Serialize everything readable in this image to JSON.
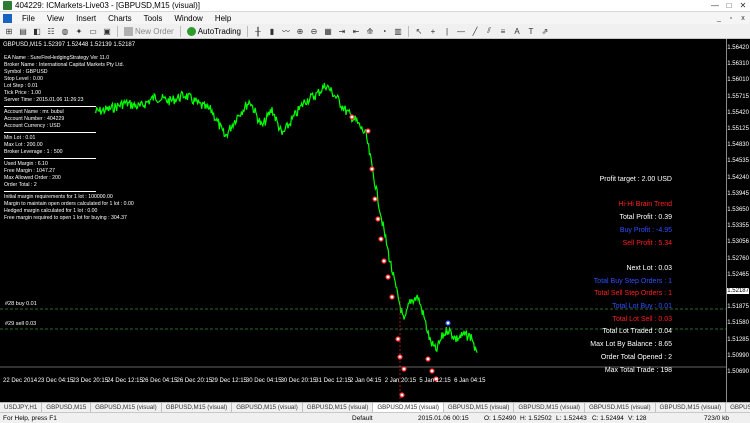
{
  "window": {
    "title": "404229: ICMarkets-Live03 - [GBPUSD,M15 (visual)]",
    "controls": [
      "—",
      "□",
      "✕"
    ]
  },
  "menu": {
    "items": [
      "File",
      "View",
      "Insert",
      "Charts",
      "Tools",
      "Window",
      "Help"
    ],
    "mdi_controls": [
      "_",
      "▫",
      "x"
    ]
  },
  "toolbar": {
    "new_order": "New Order",
    "autotrading": "AutoTrading",
    "icons": [
      "new-chart-icon",
      "open-icon",
      "profiles-icon",
      "market-watch-icon",
      "data-window-icon",
      "navigator-icon",
      "terminal-icon",
      "tester-icon",
      "new-order-icon",
      "autotrading-icon",
      "bar-chart-icon",
      "candlestick-icon",
      "line-chart-icon",
      "zoom-in-icon",
      "zoom-out-icon",
      "tile-icon",
      "autoscroll-icon",
      "chart-shift-icon",
      "indicators-icon",
      "periods-icon",
      "templates-icon",
      "cursor-icon",
      "crosshair-icon",
      "vertical-line-icon",
      "horizontal-line-icon",
      "trendline-icon",
      "channel-icon",
      "fibonacci-icon",
      "text-icon",
      "label-icon",
      "arrows-icon"
    ]
  },
  "chart": {
    "symbol_line": "GBPUSD,M15  1.52397 1.52448 1.52139 1.52187",
    "colors": {
      "background": "#000000",
      "price_line": "#00ff00",
      "sell_marker": "#ff3030",
      "buy_marker": "#3050ff",
      "trade_line": "#3a8a3a"
    },
    "info_panel": {
      "lines_1": [
        "EA Name : SureFireHedgingStrategy Ver 11.0",
        "Broker Name : International Capital Markets Pty Ltd.",
        "Symbol : GBPUSD",
        "Stop Level : 0.00",
        "Lot Step : 0.01",
        "Tick Price : 1.00",
        "Server Time : 2015.01.06 11:26:23"
      ],
      "lines_2": [
        "Account Name : mr. bubul",
        "Account Number : 404229",
        "Account Currency : USD"
      ],
      "lines_3": [
        "Min Lot : 0.01",
        "Max Lot : 200.00",
        "Broker Leverage : 1 : 500"
      ],
      "lines_4": [
        "Used Margin : 6.10",
        "Free Margin : 1047.27",
        "Max Allowed Order : 200",
        "Order Total : 2"
      ],
      "lines_5": [
        "Initial margin requirements for 1 lot : 100000.00",
        "Margin to maintain open orders calculated for 1 lot : 0.00",
        "Hedged margin calculated for 1 lot : 0.00",
        "Free margin required to open 1 lot for buying : 304.37"
      ]
    },
    "stats": [
      {
        "text": "Profit target : 2.00 USD",
        "color": "#ffffff"
      },
      {
        "text": "",
        "color": "#ffffff"
      },
      {
        "text": "Hi-Hi Brain Trend",
        "color": "#ff2020"
      },
      {
        "text": "Total Profit : 0.39",
        "color": "#ffffff"
      },
      {
        "text": "Buy Profit : -4.95",
        "color": "#3050ff"
      },
      {
        "text": "Sell Profit : 5.34",
        "color": "#ff2020"
      },
      {
        "text": "",
        "color": "#ffffff"
      },
      {
        "text": "Next Lot : 0.03",
        "color": "#ffffff"
      },
      {
        "text": "Total Buy Step Orders : 1",
        "color": "#3050ff"
      },
      {
        "text": "Total Sell Step Orders : 1",
        "color": "#ff2020"
      },
      {
        "text": "Total Lot Buy : 0.01",
        "color": "#3050ff"
      },
      {
        "text": "Total Lot Sell : 0.03",
        "color": "#ff2020"
      },
      {
        "text": "Total Lot Traded : 0.04",
        "color": "#ffffff"
      },
      {
        "text": "Max Lot By Balance : 8.65",
        "color": "#ffffff"
      },
      {
        "text": "Order Total Opened : 2",
        "color": "#ffffff"
      },
      {
        "text": "Max Total Trade : 198",
        "color": "#ffffff"
      }
    ],
    "trade_labels": [
      "#28 buy 0.01",
      "#29 sell 0.03"
    ],
    "price_labels": [
      "1.56420",
      "1.56310",
      "1.56010",
      "1.55715",
      "1.55420",
      "1.55125",
      "1.54830",
      "1.54535",
      "1.54240",
      "1.53945",
      "1.53650",
      "1.53355",
      "1.53056",
      "1.52760",
      "1.52465",
      "1.52187",
      "1.51875",
      "1.51580",
      "1.51285",
      "1.50990",
      "1.50690"
    ],
    "time_labels": [
      "22 Dec 2014",
      "23 Dec 04:15",
      "23 Dec 20:15",
      "24 Dec 12:15",
      "26 Dec 04:15",
      "26 Dec 20:15",
      "29 Dec 12:15",
      "30 Dec 04:15",
      "30 Dec 20:15",
      "31 Dec 12:15",
      "2 Jan 04:15",
      "2 Jan 20:15",
      "5 Jan 12:15",
      "6 Jan 04:15"
    ]
  },
  "tabs": [
    "USDJPY,H1",
    "GBPUSD,M15",
    "GBPUSD,M15 (visual)",
    "GBPUSD,M15 (visual)",
    "GBPUSD,M15 (visual)",
    "GBPUSD,M15 (visual)",
    "GBPUSD,M15 (visual)",
    "GBPUSD,M15 (visual)",
    "GBPUSD,M15 (visual)",
    "GBPUSD,M15 (visual)",
    "GBPUSD,M15 (visual)",
    "GBPUSD,M15 (visual)",
    "GBPUSD,M15",
    "GBPUSD,M15 (visual)",
    "GBPUSD,M15",
    "GBPUSD,M15",
    "GBPUSD,M15"
  ],
  "statusbar": {
    "help": "For Help, press F1",
    "profile": "Default",
    "time": "2015.01.06 00:15",
    "open": "O: 1.52490",
    "high": "H: 1.52502",
    "low": "L: 1.52443",
    "close": "C: 1.52494",
    "volume": "V: 128",
    "traffic": "723/0 kb"
  }
}
